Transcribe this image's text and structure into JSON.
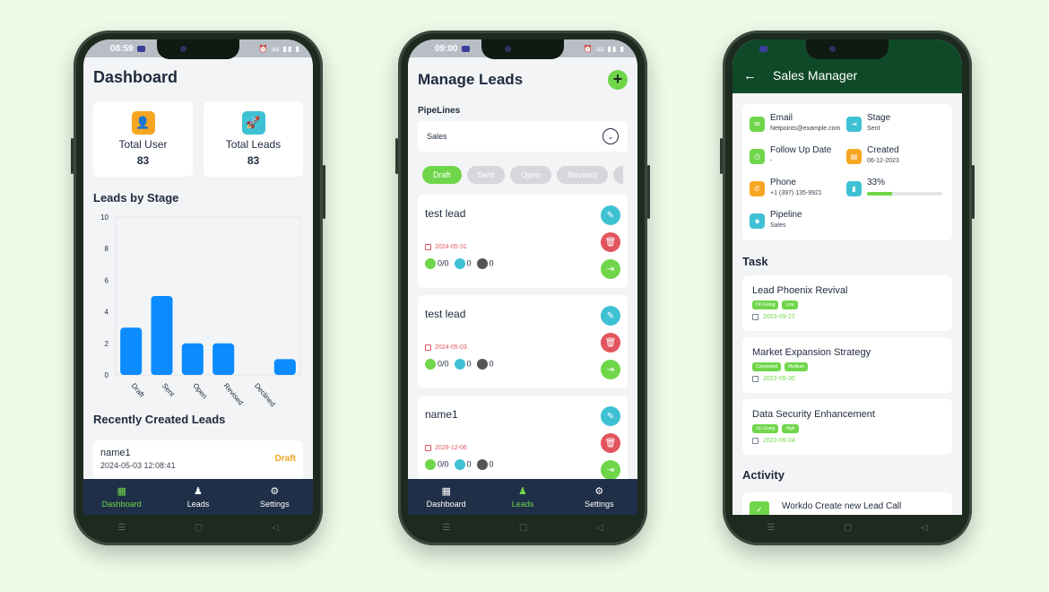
{
  "phone1": {
    "status": {
      "time": "08:59",
      "icons": "⏰ ⅏ ▮▮ ▮"
    },
    "title": "Dashboard",
    "stats": [
      {
        "label": "Total User",
        "value": "83",
        "color": "#f7a623"
      },
      {
        "label": "Total Leads",
        "value": "83",
        "color": "#3fc1d4"
      }
    ],
    "chart_title": "Leads by Stage",
    "recent_title": "Recently Created Leads",
    "recent": {
      "name": "name1",
      "date": "2024-05-03 12:08:41",
      "status": "Draft"
    },
    "tabs": [
      {
        "label": "Dashboard",
        "glyph": "▦",
        "active": true
      },
      {
        "label": "Leads",
        "glyph": "♟",
        "active": false
      },
      {
        "label": "Settings",
        "glyph": "⚙",
        "active": false
      }
    ]
  },
  "chart_data": {
    "type": "bar",
    "categories": [
      "Draft",
      "Sent",
      "Open",
      "Revised",
      "Declined",
      ""
    ],
    "values": [
      3,
      5,
      2,
      2,
      0,
      1
    ],
    "yticks": [
      "0",
      "2",
      "4",
      "6",
      "8",
      "10"
    ],
    "ylim": [
      0,
      10
    ],
    "color": "#0a8cff",
    "grid": false
  },
  "phone2": {
    "status": {
      "time": "09:00",
      "icons": "⏰ ⅏ ▮▮ ▮"
    },
    "title": "Manage Leads",
    "add_label": "+",
    "pipelines_label": "PipeLines",
    "pipeline_value": "Sales",
    "chips": [
      "Draft",
      "Sent",
      "Open",
      "Revised",
      ""
    ],
    "leads": [
      {
        "name": "test lead",
        "date": "2024-05-31",
        "tasks": "0/0",
        "products": "0",
        "sources": "0"
      },
      {
        "name": "test lead",
        "date": "2024-05-03",
        "tasks": "0/0",
        "products": "0",
        "sources": "0"
      },
      {
        "name": "name1",
        "date": "2029-12-06",
        "tasks": "0/0",
        "products": "0",
        "sources": "0"
      }
    ],
    "tabs": [
      {
        "label": "Dashboard",
        "glyph": "▦",
        "active": false
      },
      {
        "label": "Leads",
        "glyph": "♟",
        "active": true
      },
      {
        "label": "Settings",
        "glyph": "⚙",
        "active": false
      }
    ]
  },
  "phone3": {
    "header_title": "Sales Manager",
    "info": {
      "email_label": "Email",
      "email_value": "Netpoints@example.com",
      "stage_label": "Stage",
      "stage_value": "Sent",
      "followup_label": "Follow Up Date",
      "followup_value": "-",
      "created_label": "Created",
      "created_value": "06-12-2023",
      "phone_label": "Phone",
      "phone_value": "+1 (397) 135-9921",
      "progress_label": "33%",
      "progress_fraction": 0.33,
      "pipeline_label": "Pipeline",
      "pipeline_value": "Sales"
    },
    "task_title": "Task",
    "tasks": [
      {
        "title": "Lead Phoenix Revival",
        "status": "On Going",
        "priority": "Low",
        "date": "2023-09-27"
      },
      {
        "title": "Market Expansion Strategy",
        "status": "Completed",
        "priority": "Medium",
        "date": "2023-09-30"
      },
      {
        "title": "Data Security Enhancement",
        "status": "On Going",
        "priority": "High",
        "date": "2023-09-24"
      }
    ],
    "activity_title": "Activity",
    "activity_item": "Workdo Create new Lead Call"
  },
  "colors": {
    "accent": "#6fd64a",
    "nav": "#1f2f47",
    "header": "#0f4a28",
    "danger": "#e2555e",
    "info": "#3fc1d4",
    "warning": "#f7a623"
  }
}
